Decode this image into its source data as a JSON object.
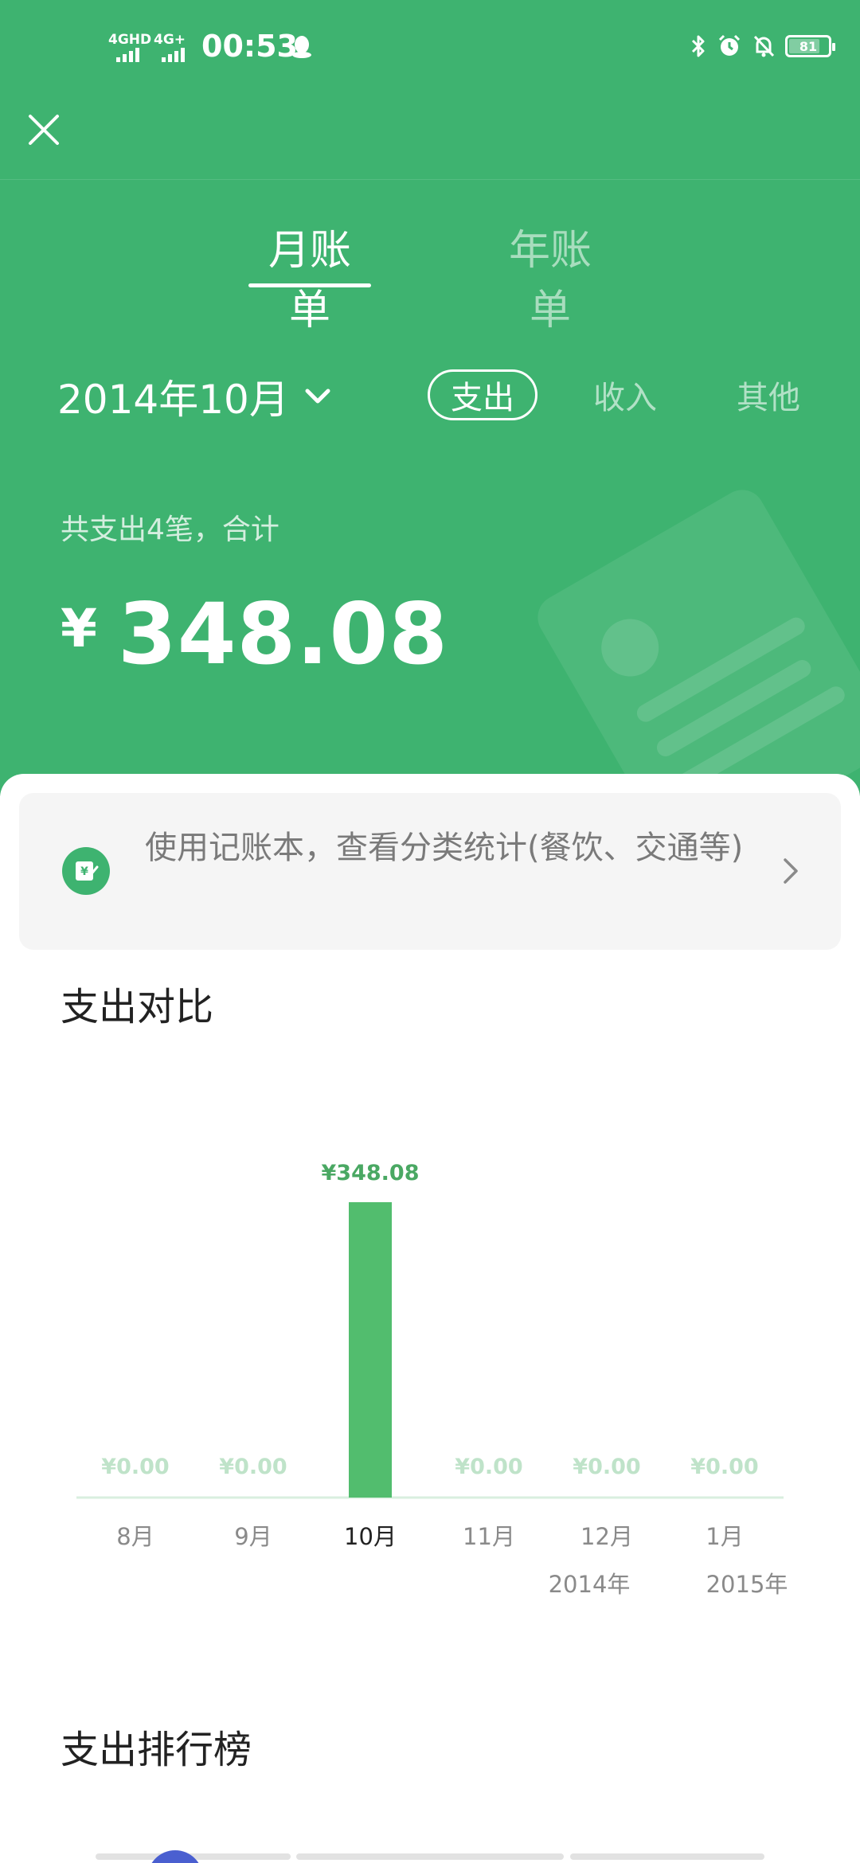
{
  "status_bar": {
    "network1": "4GHD",
    "network2": "4G+",
    "time": "00:53",
    "battery": "81",
    "battery_level_percent": 81
  },
  "tabs": {
    "month": "月账单",
    "year": "年账单"
  },
  "date_selector": {
    "label": "2014年10月"
  },
  "type_filter": {
    "expense": "支出",
    "income": "收入",
    "other": "其他"
  },
  "summary": {
    "description": "共支出4笔，合计",
    "currency": "¥",
    "total": "348.08"
  },
  "promo": {
    "text": "使用记账本，查看分类统计(餐饮、交通等)"
  },
  "sections": {
    "comparison_title": "支出对比",
    "ranking_title": "支出排行榜"
  },
  "colors": {
    "brand_green": "#3eb370",
    "bar_green": "#52bd6e",
    "zero_label_green": "#bfe3c9"
  },
  "chart_data": {
    "type": "bar",
    "categories": [
      "8月",
      "9月",
      "10月",
      "11月",
      "12月",
      "1月"
    ],
    "values": [
      0,
      0,
      348.08,
      0,
      0,
      0
    ],
    "value_labels": [
      "¥0.00",
      "¥0.00",
      "¥348.08",
      "¥0.00",
      "¥0.00",
      "¥0.00"
    ],
    "year_labels": [
      {
        "category": "12月",
        "text": "2014年"
      },
      {
        "category": "1月",
        "text": "2015年"
      }
    ],
    "highlight_category": "10月",
    "grid": false,
    "legend": "none",
    "title": "",
    "xlabel": "",
    "ylabel": ""
  }
}
